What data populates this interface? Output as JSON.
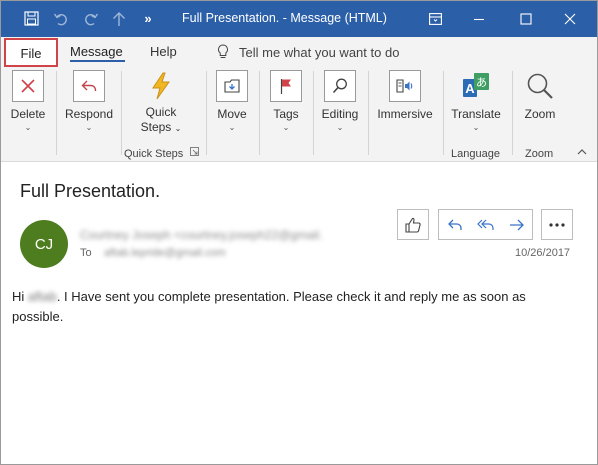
{
  "window": {
    "title": "Full Presentation.  -  Message (HTML)",
    "icons": [
      "save-icon",
      "undo-icon",
      "redo-icon",
      "up-arrow-icon",
      "more-icon",
      "ribbon-display-icon",
      "minimize-icon",
      "maximize-icon",
      "close-icon"
    ]
  },
  "tabs": {
    "file": "File",
    "message": "Message",
    "help": "Help",
    "tell_me": "Tell me what you want to do"
  },
  "ribbon": {
    "delete": "Delete",
    "respond": "Respond",
    "quick_steps_1": "Quick",
    "quick_steps_2": "Steps",
    "move": "Move",
    "tags": "Tags",
    "editing": "Editing",
    "immersive": "Immersive",
    "translate": "Translate",
    "zoom": "Zoom",
    "group_quick_steps": "Quick Steps",
    "group_language": "Language",
    "group_zoom": "Zoom"
  },
  "message": {
    "subject": "Full Presentation.",
    "avatar_initials": "CJ",
    "sender": "Courtney Joseph <courtney.joseph22@gmail.",
    "to_label": "To",
    "to_value": "aftab.lepride@gmail.com",
    "date": "10/26/2017",
    "body_hi": "Hi",
    "body_name": "aftab",
    "body_rest": ". I Have sent you complete presentation. Please check it and reply me as soon as possible."
  },
  "colors": {
    "titlebar": "#2b5fa8",
    "avatar": "#4d7d1e",
    "file_highlight": "#d0434a",
    "action_icons": "#3b73c6"
  }
}
